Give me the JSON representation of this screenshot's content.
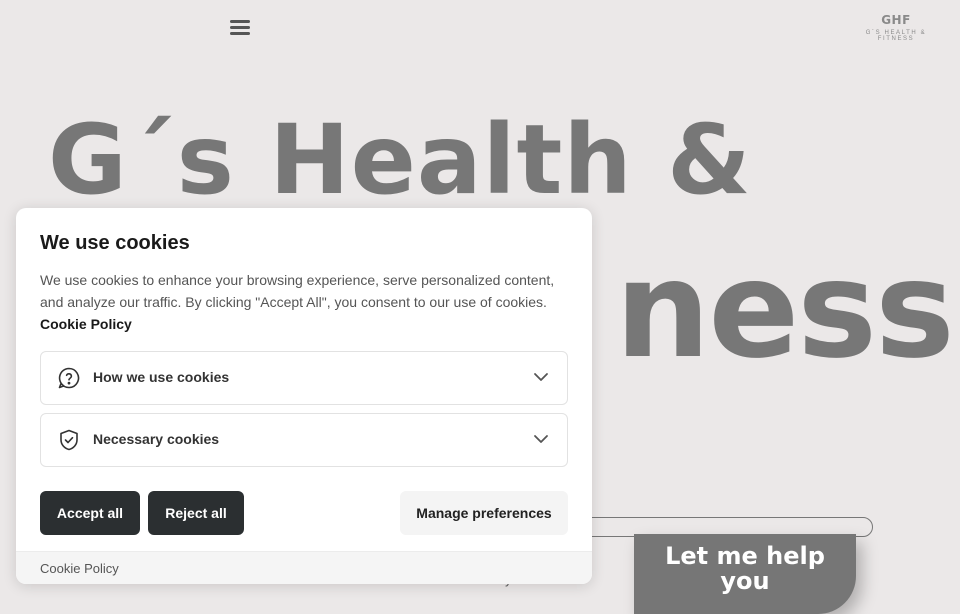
{
  "header": {
    "logo_mark": "GHF",
    "logo_subtitle": "G´S HEALTH & FITNESS"
  },
  "hero": {
    "line1": "G´s Health &",
    "line2": "ness",
    "cta_line1": "Let me help",
    "cta_line2": "you",
    "stray_text": "y"
  },
  "cookie": {
    "title": "We use cookies",
    "description": "We use cookies to enhance your browsing experience, serve personalized content, and analyze our traffic. By clicking \"Accept All\", you consent to our use of cookies.",
    "policy_link": "Cookie Policy",
    "accordion": [
      {
        "label": "How we use cookies",
        "icon": "question-bubble-icon"
      },
      {
        "label": "Necessary cookies",
        "icon": "shield-check-icon"
      }
    ],
    "buttons": {
      "accept": "Accept all",
      "reject": "Reject all",
      "manage": "Manage preferences"
    },
    "footer_link": "Cookie Policy"
  },
  "colors": {
    "background": "#ebe8e8",
    "hero_text": "#777777",
    "dark_button": "#2b2f31",
    "light_button": "#f4f4f4"
  }
}
